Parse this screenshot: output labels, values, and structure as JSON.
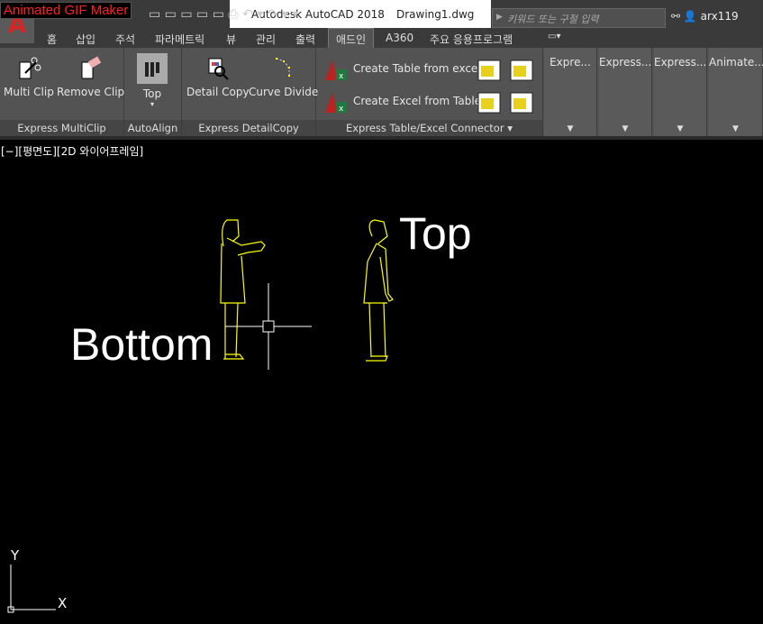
{
  "overlay_label": "Animated GIF Maker",
  "app_title": "Autodesk AutoCAD 2018",
  "document_title": "Drawing1.dwg",
  "search": {
    "placeholder": "키워드 또는 구절 입력"
  },
  "user": {
    "name": "arx119"
  },
  "tabs": [
    {
      "label": "홈"
    },
    {
      "label": "삽입"
    },
    {
      "label": "주석"
    },
    {
      "label": "파라메트릭"
    },
    {
      "label": "뷰"
    },
    {
      "label": "관리"
    },
    {
      "label": "출력"
    },
    {
      "label": "애드인",
      "active": true
    },
    {
      "label": "A360"
    },
    {
      "label": "주요 응용프로그램"
    }
  ],
  "ribbon": {
    "panels": [
      {
        "title": "Express MultiClip",
        "buttons": [
          "Multi Clip",
          "Remove Clip"
        ]
      },
      {
        "title": "AutoAlign",
        "buttons": [
          "Top"
        ]
      },
      {
        "title": "Express DetailCopy",
        "buttons": [
          "Detail Copy",
          "Curve Divide"
        ]
      },
      {
        "title": "Express Table/Excel Connector",
        "buttons": [
          "Create Table from excel",
          "Create Excel from Table"
        ]
      }
    ],
    "collapsed": [
      "Expre...",
      "Express...",
      "Express...",
      "Animate..."
    ]
  },
  "viewport": {
    "label": "[−][평면도][2D 와이어프레임]",
    "texts": [
      "Top",
      "Bottom"
    ],
    "ucs": {
      "x": "X",
      "y": "Y"
    }
  },
  "colors": {
    "drawing": "#ffff00",
    "canvas": "#000000",
    "ribbon": "#535353"
  }
}
